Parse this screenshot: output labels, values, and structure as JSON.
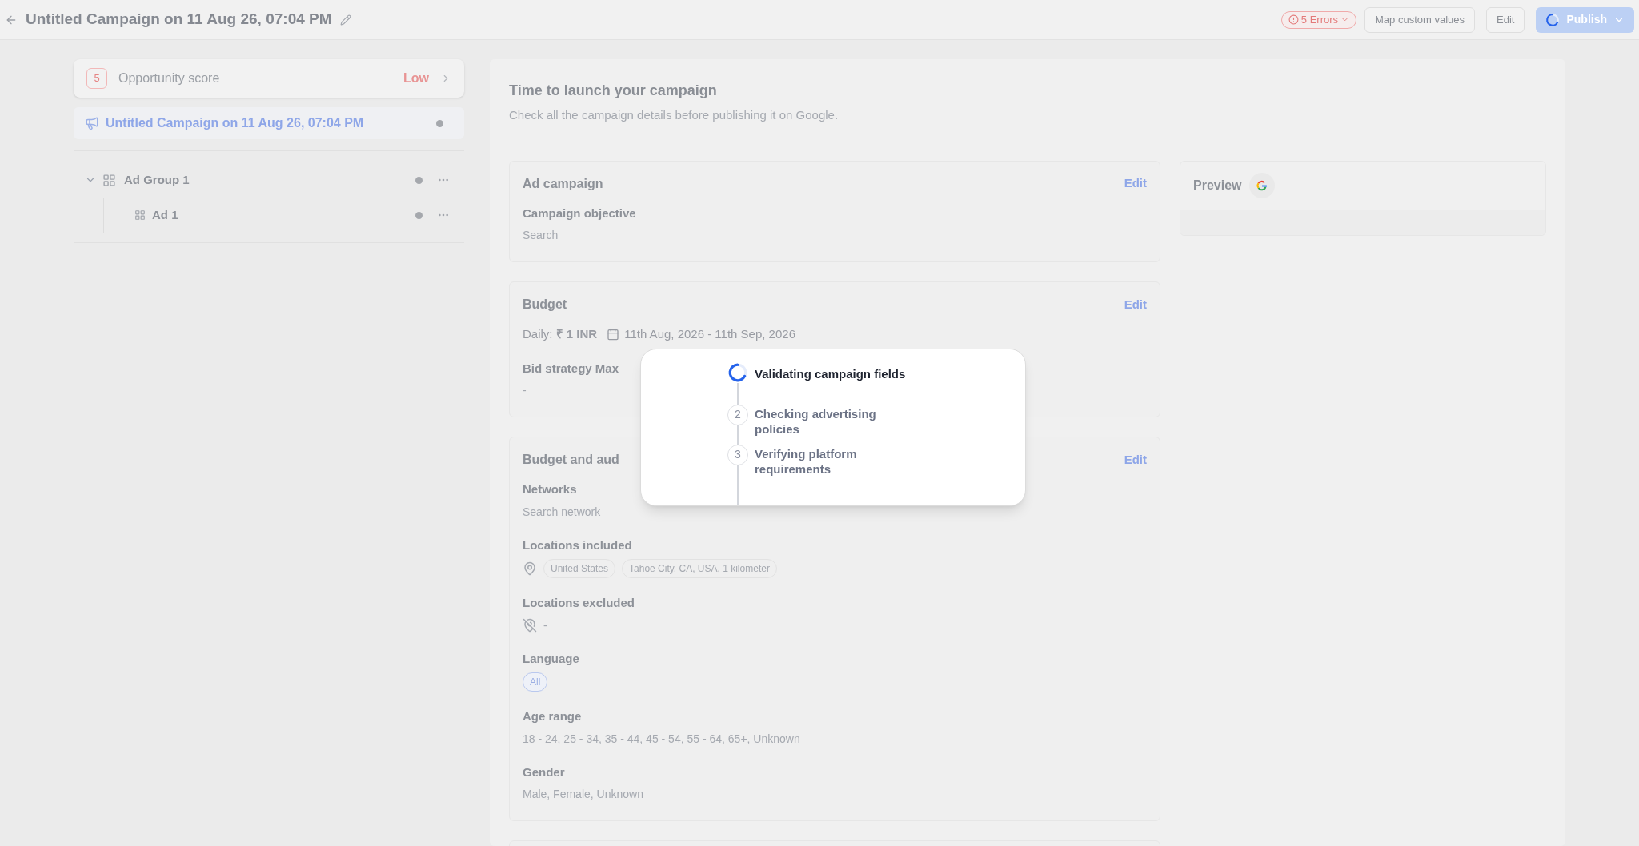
{
  "header": {
    "title": "Untitled Campaign on 11 Aug 26, 07:04 PM",
    "errors": "5 Errors",
    "buttons": [
      {
        "label": "Map custom values",
        "kind": "secondary",
        "loading": false
      },
      {
        "label": "Edit",
        "kind": "secondary",
        "loading": false
      },
      {
        "label": "Publish",
        "kind": "primary",
        "loading": true
      }
    ]
  },
  "sidebar": {
    "score": {
      "value": "5",
      "label": "Opportunity score",
      "rating": "Low"
    },
    "campaign": {
      "name": "Untitled Campaign on 11 Aug 26, 07:04 PM",
      "selected": true
    },
    "tree": [
      {
        "label": "Ad Group 1",
        "expanded": true,
        "children": [
          {
            "label": "Ad 1",
            "expanded": false
          }
        ]
      }
    ]
  },
  "main": {
    "title": "Time to launch your campaign",
    "subtitle": "Check all the campaign details before publishing it on Google.",
    "cards": [
      {
        "title": "Ad campaign",
        "action": "Edit",
        "fields": [
          {
            "kind": "text",
            "label": "Campaign objective",
            "value": "Search"
          }
        ]
      },
      {
        "title": "Budget",
        "action": "Edit",
        "fields": [
          {
            "kind": "budget",
            "daily": "Daily: **₹ 1 INR**",
            "dates": "11th Aug, 2026 - 11th Sep, 2026"
          },
          {
            "kind": "text",
            "label": "Bid strategy Max",
            "value": "-"
          }
        ]
      },
      {
        "title": "Budget and aud",
        "action": "Edit",
        "fields": [
          {
            "kind": "text",
            "label": "Networks",
            "value": "Search network"
          },
          {
            "kind": "locations",
            "label": "Locations included",
            "chips": [
              "United States",
              "Tahoe City, CA, USA, 1 kilometer"
            ]
          },
          {
            "kind": "excluded",
            "label": "Locations excluded",
            "value": "-"
          },
          {
            "kind": "pills",
            "label": "Language",
            "chips": [
              "All"
            ]
          },
          {
            "kind": "text",
            "label": "Age range",
            "value": "18 - 24, 25 - 34, 35 - 44, 45 - 54, 55 - 64, 65+, Unknown"
          },
          {
            "kind": "text",
            "label": "Gender",
            "value": "Male, Female, Unknown"
          }
        ]
      }
    ],
    "preview": {
      "title": "Preview"
    }
  },
  "modal": {
    "steps": [
      {
        "active": true,
        "label": "Validating campaign fields"
      },
      {
        "active": false,
        "number": "2",
        "label": "Checking advertising policies"
      },
      {
        "active": false,
        "number": "3",
        "label": "Verifying platform requirements"
      }
    ]
  }
}
